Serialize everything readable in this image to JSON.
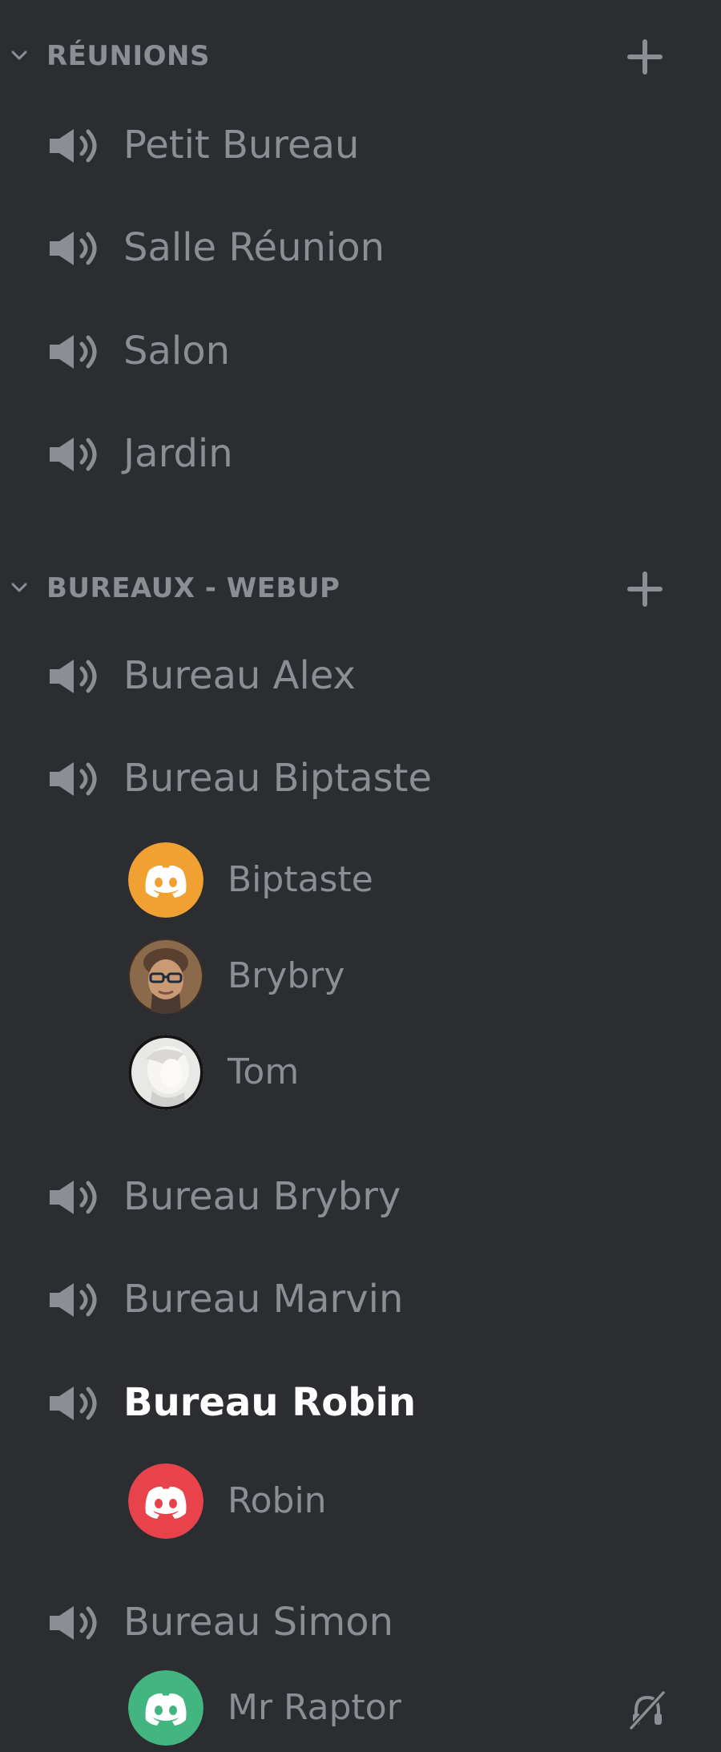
{
  "categories": [
    {
      "label": "RÉUNIONS",
      "channels": [
        {
          "name": "Petit Bureau"
        },
        {
          "name": "Salle Réunion"
        },
        {
          "name": "Salon"
        },
        {
          "name": "Jardin"
        }
      ]
    },
    {
      "label": "BUREAUX - WEBUP",
      "channels": [
        {
          "name": "Bureau Alex"
        },
        {
          "name": "Bureau Biptaste",
          "members": [
            {
              "name": "Biptaste",
              "avatar": "discord-logo-orange"
            },
            {
              "name": "Brybry",
              "avatar": "photo-person-glasses"
            },
            {
              "name": "Tom",
              "avatar": "illustrated-white-character"
            }
          ]
        },
        {
          "name": "Bureau Brybry"
        },
        {
          "name": "Bureau Marvin"
        },
        {
          "name": "Bureau Robin",
          "active": true,
          "members": [
            {
              "name": "Robin",
              "avatar": "discord-logo-red"
            }
          ]
        },
        {
          "name": "Bureau Simon",
          "members": [
            {
              "name": "Mr Raptor",
              "avatar": "discord-logo-green",
              "status_icon": "deafened-icon"
            }
          ]
        }
      ]
    }
  ],
  "icons": {
    "category_collapse": "chevron-down-icon",
    "category_add": "plus-icon",
    "channel": "speaker-icon"
  },
  "colors": {
    "background": "#2b2d31",
    "muted_text": "#8b8e94",
    "active_text": "#ffffff",
    "avatar_orange": "#f0a132",
    "avatar_red": "#e8434b",
    "avatar_green": "#43b581"
  }
}
